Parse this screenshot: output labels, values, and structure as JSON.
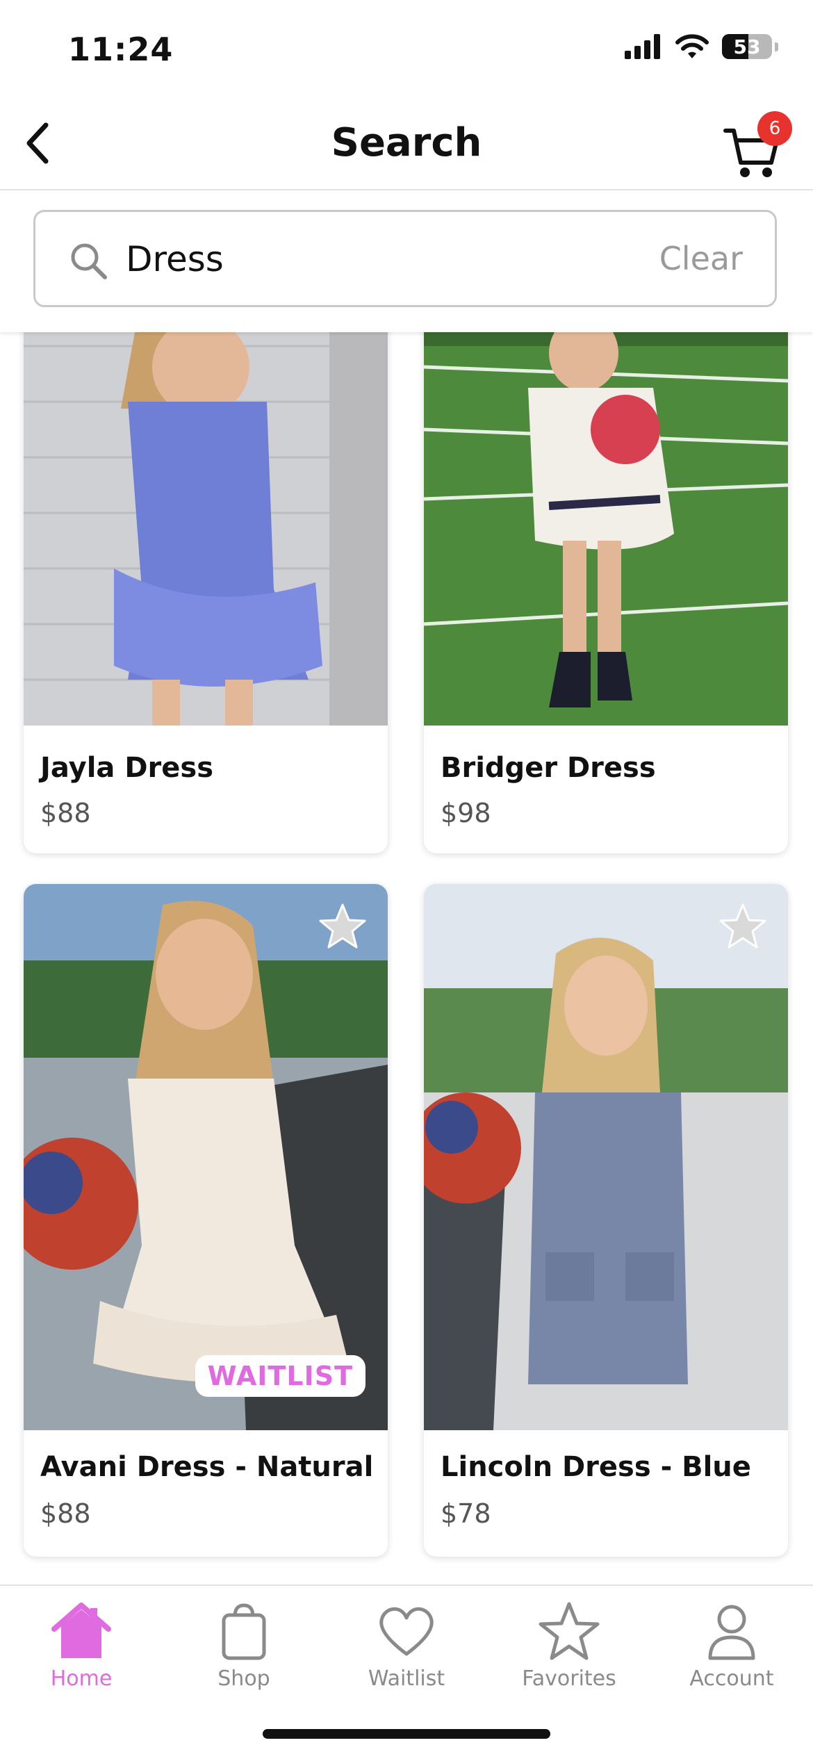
{
  "status_bar": {
    "time": "11:24",
    "battery": "53",
    "battery_level": 0.53
  },
  "header": {
    "title": "Search",
    "cart_count": "6",
    "back_icon": "chevron-left-icon",
    "cart_icon": "cart-icon"
  },
  "search": {
    "value": "Dress",
    "placeholder": "Search",
    "clear_label": "Clear"
  },
  "products": [
    {
      "name": "Jayla Dress",
      "price": "$88"
    },
    {
      "name": "Bridger Dress",
      "price": "$98"
    },
    {
      "name": "Avani Dress - Natural",
      "price": "$88",
      "badge": "WAITLIST"
    },
    {
      "name": "Lincoln Dress - Blue",
      "price": "$78"
    }
  ],
  "tabs": [
    {
      "label": "Home",
      "icon": "home-icon",
      "active": true
    },
    {
      "label": "Shop",
      "icon": "shopping-bag-icon",
      "active": false
    },
    {
      "label": "Waitlist",
      "icon": "heart-icon",
      "active": false
    },
    {
      "label": "Favorites",
      "icon": "star-icon",
      "active": false
    },
    {
      "label": "Account",
      "icon": "person-icon",
      "active": false
    }
  ],
  "colors": {
    "accent": "#e06ae0",
    "badge": "#e8322d",
    "text": "#111111",
    "muted": "#8a8a8a"
  }
}
